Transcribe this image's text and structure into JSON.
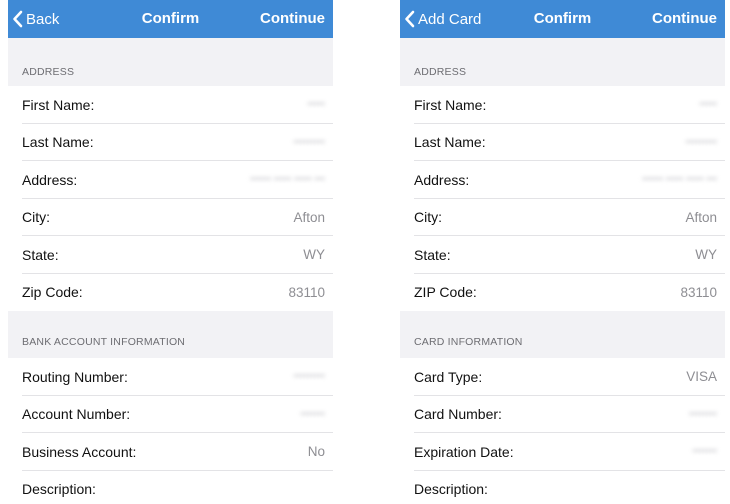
{
  "left": {
    "nav": {
      "back": "Back",
      "title": "Confirm",
      "continue": "Continue"
    },
    "address_header": "ADDRESS",
    "address_rows": [
      {
        "label": "First Name:",
        "value": "•••••",
        "blurred": true
      },
      {
        "label": "Last Name:",
        "value": "•••••••••",
        "blurred": true
      },
      {
        "label": "Address:",
        "value": "•••••• ••••• ••••• •••",
        "blurred": true
      },
      {
        "label": "City:",
        "value": "Afton",
        "blurred": false
      },
      {
        "label": "State:",
        "value": "WY",
        "blurred": false
      },
      {
        "label": "Zip Code:",
        "value": "83110",
        "blurred": false
      }
    ],
    "second_header": "BANK ACCOUNT INFORMATION",
    "second_rows": [
      {
        "label": "Routing Number:",
        "value": "•••••••••",
        "blurred": true
      },
      {
        "label": "Account Number:",
        "value": "•••••••",
        "blurred": true
      },
      {
        "label": "Business Account:",
        "value": "No",
        "blurred": false
      },
      {
        "label": "Description:",
        "value": "",
        "blurred": false
      }
    ]
  },
  "right": {
    "nav": {
      "back": "Add Card",
      "title": "Confirm",
      "continue": "Continue"
    },
    "address_header": "ADDRESS",
    "address_rows": [
      {
        "label": "First Name:",
        "value": "•••••",
        "blurred": true
      },
      {
        "label": "Last Name:",
        "value": "•••••••••",
        "blurred": true
      },
      {
        "label": "Address:",
        "value": "•••••• ••••• ••••• •••",
        "blurred": true
      },
      {
        "label": "City:",
        "value": "Afton",
        "blurred": false
      },
      {
        "label": "State:",
        "value": "WY",
        "blurred": false
      },
      {
        "label": "ZIP Code:",
        "value": "83110",
        "blurred": false
      }
    ],
    "second_header": "CARD INFORMATION",
    "second_rows": [
      {
        "label": "Card Type:",
        "value": "VISA",
        "blurred": false
      },
      {
        "label": "Card Number:",
        "value": "••••••••",
        "blurred": true
      },
      {
        "label": "Expiration Date:",
        "value": "•••••••",
        "blurred": true
      },
      {
        "label": "Description:",
        "value": "",
        "blurred": false
      }
    ]
  },
  "colors": {
    "navbar": "#3f8ad6",
    "section_bg": "#f2f2f5",
    "value_text": "#8e8e93"
  },
  "icons": {
    "back": "chevron-left-icon"
  }
}
